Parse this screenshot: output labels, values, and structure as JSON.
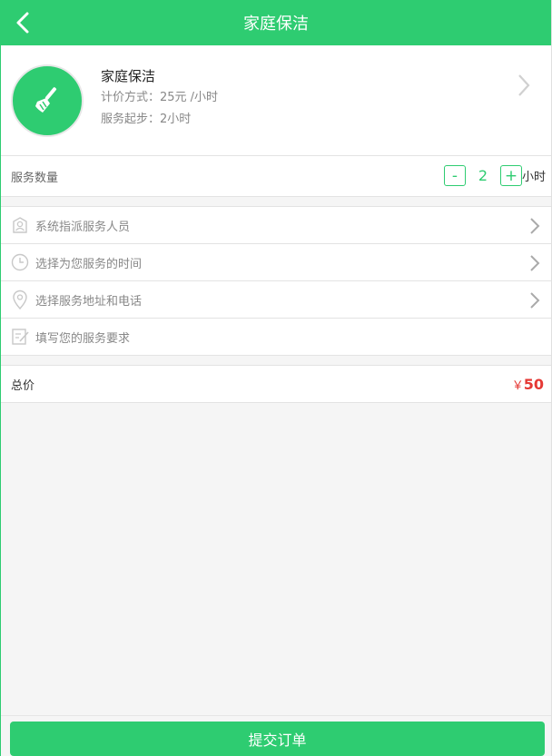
{
  "header": {
    "title": "家庭保洁",
    "back_icon": "chevron-left-icon"
  },
  "service": {
    "name": "家庭保洁",
    "pricing": "计价方式：25元 /小时",
    "minimum": "服务起步：2小时",
    "icon": "broom-icon"
  },
  "quantity": {
    "label": "服务数量",
    "minus": "-",
    "value": "2",
    "plus": "+",
    "unit": "小时"
  },
  "options": [
    {
      "label": "系统指派服务人员",
      "icon": "staff-badge-icon"
    },
    {
      "label": "选择为您服务的时间",
      "icon": "clock-icon"
    },
    {
      "label": "选择服务地址和电话",
      "icon": "location-pin-icon"
    },
    {
      "label": "填写您的服务要求",
      "icon": "note-edit-icon"
    }
  ],
  "total": {
    "label": "总价",
    "currency": "￥",
    "amount": "50"
  },
  "footer": {
    "submit": "提交订单"
  },
  "colors": {
    "accent": "#2ecc71",
    "price": "#e53935"
  }
}
